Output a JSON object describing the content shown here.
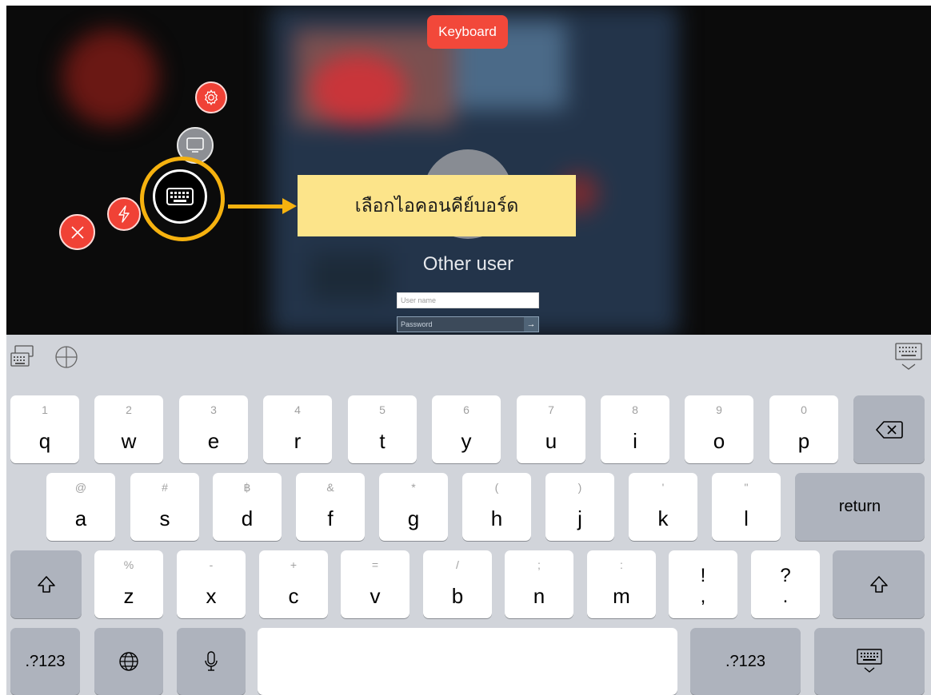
{
  "overlay": {
    "keyboard_pill": "Keyboard",
    "callout": "เลือกไอคอนคีย์บอร์ด"
  },
  "remote": {
    "user_name": "Other user",
    "username_placeholder": "User name",
    "password_placeholder": "Password"
  },
  "keyboard": {
    "row1": [
      {
        "hint": "1",
        "key": "q"
      },
      {
        "hint": "2",
        "key": "w"
      },
      {
        "hint": "3",
        "key": "e"
      },
      {
        "hint": "4",
        "key": "r"
      },
      {
        "hint": "5",
        "key": "t"
      },
      {
        "hint": "6",
        "key": "y"
      },
      {
        "hint": "7",
        "key": "u"
      },
      {
        "hint": "8",
        "key": "i"
      },
      {
        "hint": "9",
        "key": "o"
      },
      {
        "hint": "0",
        "key": "p"
      }
    ],
    "row2": [
      {
        "hint": "@",
        "key": "a"
      },
      {
        "hint": "#",
        "key": "s"
      },
      {
        "hint": "฿",
        "key": "d"
      },
      {
        "hint": "&",
        "key": "f"
      },
      {
        "hint": "*",
        "key": "g"
      },
      {
        "hint": "(",
        "key": "h"
      },
      {
        "hint": ")",
        "key": "j"
      },
      {
        "hint": "'",
        "key": "k"
      },
      {
        "hint": "\"",
        "key": "l"
      }
    ],
    "row3": [
      {
        "hint": "%",
        "key": "z"
      },
      {
        "hint": "-",
        "key": "x"
      },
      {
        "hint": "+",
        "key": "c"
      },
      {
        "hint": "=",
        "key": "v"
      },
      {
        "hint": "/",
        "key": "b"
      },
      {
        "hint": ";",
        "key": "n"
      },
      {
        "hint": ":",
        "key": "m"
      }
    ],
    "punct": [
      {
        "top": "!",
        "bottom": ","
      },
      {
        "top": "?",
        "bottom": "."
      }
    ],
    "return_label": "return",
    "numbers_label": ".?123"
  }
}
